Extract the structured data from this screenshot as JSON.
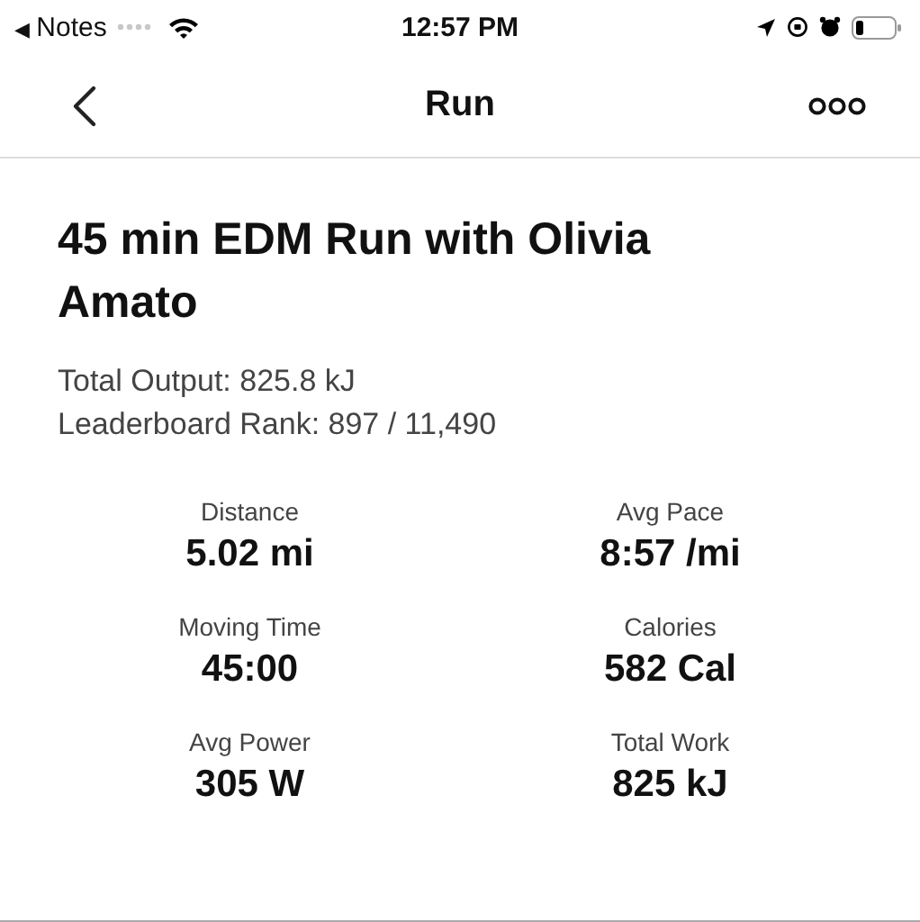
{
  "status_bar": {
    "back_arrow": "◀",
    "back_app": "Notes",
    "time": "12:57 PM"
  },
  "nav": {
    "title": "Run"
  },
  "workout": {
    "title": "45 min EDM Run with Olivia Amato",
    "lines": [
      "Total Output: 825.8 kJ",
      "Leaderboard Rank: 897 / 11,490"
    ]
  },
  "stats": [
    {
      "label": "Distance",
      "value": "5.02 mi"
    },
    {
      "label": "Avg Pace",
      "value": "8:57 /mi"
    },
    {
      "label": "Moving Time",
      "value": "45:00"
    },
    {
      "label": "Calories",
      "value": "582 Cal"
    },
    {
      "label": "Avg Power",
      "value": "305 W"
    },
    {
      "label": "Total Work",
      "value": "825 kJ"
    }
  ]
}
